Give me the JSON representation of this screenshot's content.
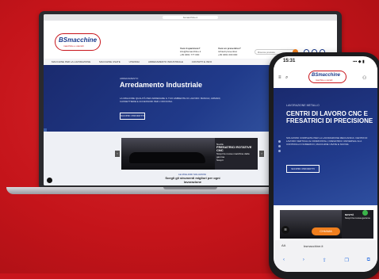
{
  "desktop": {
    "url": "bsmacchine.it",
    "logo": {
      "brand": "BSmacchine",
      "tagline": "macchine e utensili"
    },
    "contacts": [
      {
        "label": "Vuoi risparmiare?",
        "line": "info@bsmacchine.it",
        "line2": "+39 0461 777 000"
      },
      {
        "label": "Vuoi un preventivo?",
        "line": "richiedi preventivo",
        "line2": "+39 0461 000 000"
      }
    ],
    "search_placeholder": "Ricerca prodotto",
    "nav": [
      "MACCHINE PER LA LAVORAZIONE",
      "MACCHINE USATE",
      "UTENSILI",
      "ARREDAMENTO INDUSTRIALE",
      "CONTATTI E INFO"
    ],
    "hero": {
      "eyebrow": "ARREDAMENTO",
      "title": "Arredamento Industriale",
      "desc": "LA MIGLIORE QUALITÀ PER ARREDARE IL TUO AMBIENTE DI LAVORO: BANCHI, ARMADI, CASSETTIERE E ACCESSORI PER L'OFFICINA.",
      "cta": "SCOPRI I PRODOTTI"
    },
    "promo": {
      "title": "Novità",
      "subtitle": "FRESATRICI ROTATIVE CNC",
      "text": "Scopri le nuove macchine della gamma",
      "cta": "Scopri"
    },
    "below": {
      "link": "LE MIGLIORI SOLUZIONI",
      "title": "Scegli gli strumenti migliori per ogni lavorazione"
    }
  },
  "phone": {
    "time": "15:31",
    "status_icons": "▪▪▪ ◆ ▮",
    "logo": {
      "brand": "BSmacchine",
      "tagline": "macchine e utensili"
    },
    "hero": {
      "eyebrow": "LAVORAZIONE METALLO",
      "title": "CENTRI DI LAVORO CNC E FRESATRICI DI PRECISIONE",
      "desc": "SOLUZIONI COMPLETE PER LA LAVORAZIONE MECCANICA: CENTRI DI LAVORO VERTICALI E ORIZZONTALI, FRESATRICI UNIVERSALI E A CONTROLLO NUMERICO, MACCHINE USATE E NUOVE.",
      "cta": "SCOPRI I PRODOTTI"
    },
    "promo": {
      "title": "NOVITÀ",
      "text": "Scopri la nuova gamma"
    },
    "call_label": "CHIAMA",
    "address": "bsmacchine.it",
    "aa": "AA"
  }
}
